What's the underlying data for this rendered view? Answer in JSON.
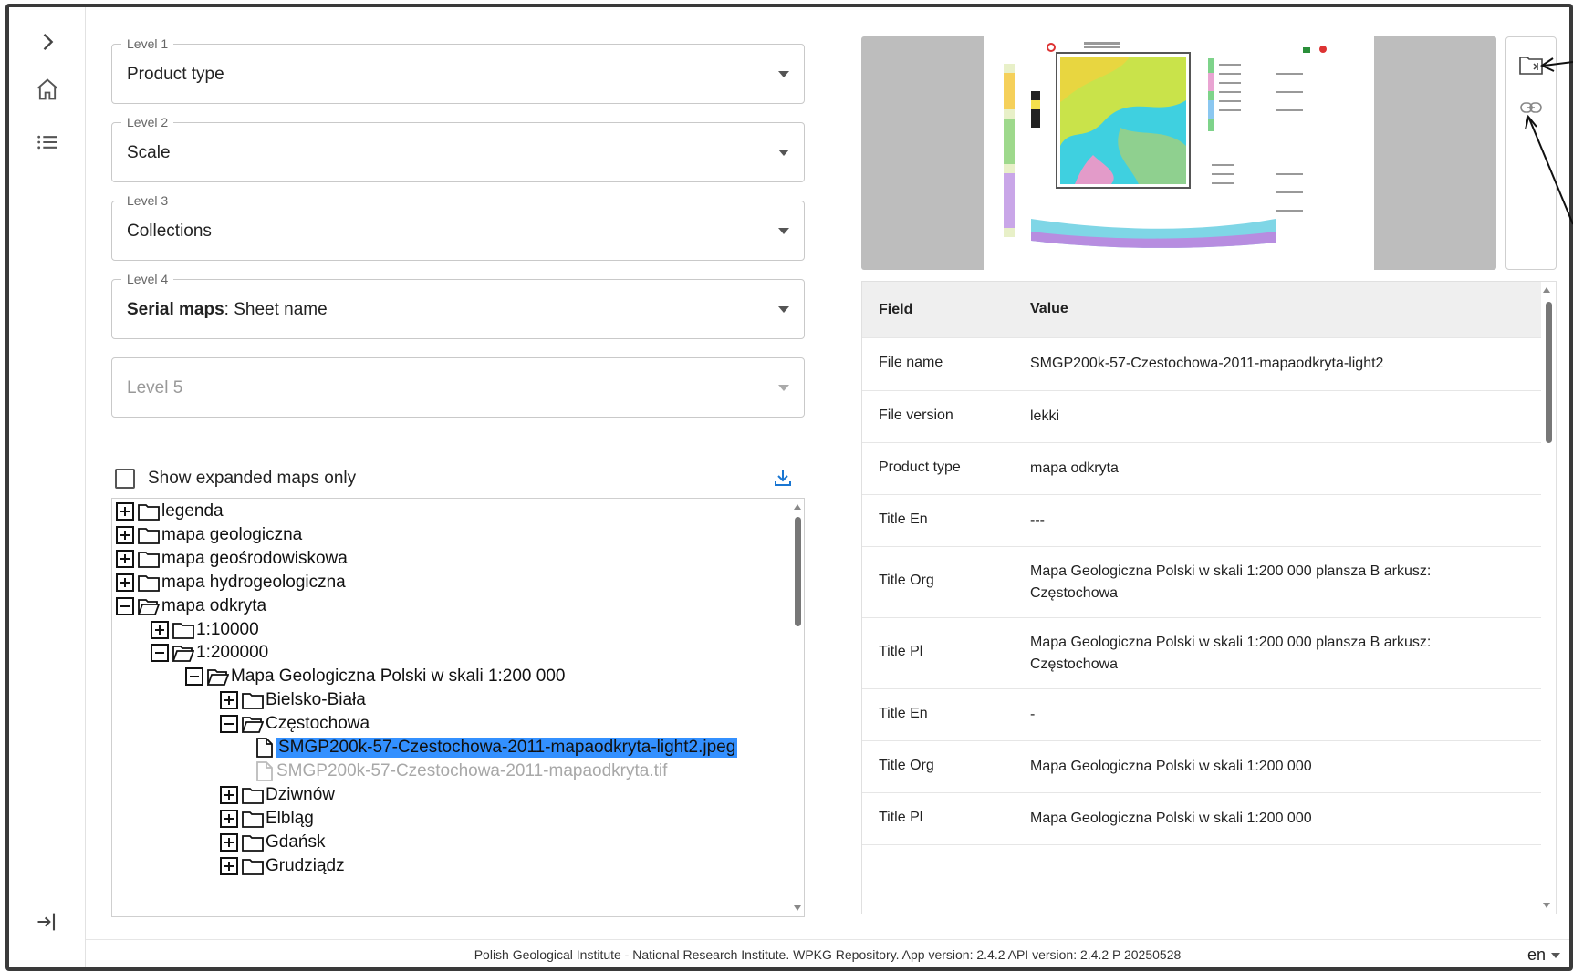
{
  "levels": [
    {
      "label": "Level 1",
      "value": "Product type"
    },
    {
      "label": "Level 2",
      "value": "Scale"
    },
    {
      "label": "Level 3",
      "value": "Collections"
    },
    {
      "label": "Level 4",
      "value_bold": "Serial maps",
      "value_rest": ": Sheet name"
    },
    {
      "placeholder": "Level 5"
    }
  ],
  "filter": {
    "show_expanded_label": "Show expanded maps only"
  },
  "tree": [
    {
      "label": "legenda"
    },
    {
      "label": "mapa geologiczna"
    },
    {
      "label": "mapa geośrodowiskowa"
    },
    {
      "label": "mapa hydrogeologiczna"
    },
    {
      "label": "mapa odkryta"
    },
    {
      "label": "1:10000"
    },
    {
      "label": "1:200000"
    },
    {
      "label": "Mapa Geologiczna Polski w skali 1:200 000"
    },
    {
      "label": "Bielsko-Biała"
    },
    {
      "label": "Częstochowa"
    },
    {
      "label": "SMGP200k-57-Czestochowa-2011-mapaodkryta-light2.jpeg"
    },
    {
      "label": "SMGP200k-57-Czestochowa-2011-mapaodkryta.tif"
    },
    {
      "label": "Dziwnów"
    },
    {
      "label": "Elbląg"
    },
    {
      "label": "Gdańsk"
    },
    {
      "label": "Grudziądz"
    }
  ],
  "metadata": {
    "header": {
      "field": "Field",
      "value": "Value"
    },
    "rows": [
      {
        "field": "File name",
        "value": "SMGP200k-57-Czestochowa-2011-mapaodkryta-light2"
      },
      {
        "field": "File version",
        "value": "lekki"
      },
      {
        "field": "Product type",
        "value": "mapa odkryta"
      },
      {
        "field": "Title En",
        "value": "---"
      },
      {
        "field": "Title Org",
        "value": "Mapa Geologiczna Polski w skali 1:200 000 plansza B arkusz: Częstochowa"
      },
      {
        "field": "Title Pl",
        "value": "Mapa Geologiczna Polski w skali 1:200 000 plansza B arkusz: Częstochowa"
      },
      {
        "field": "Title En",
        "value": "-"
      },
      {
        "field": "Title Org",
        "value": "Mapa Geologiczna Polski w skali 1:200 000"
      },
      {
        "field": "Title Pl",
        "value": "Mapa Geologiczna Polski w skali 1:200 000"
      }
    ]
  },
  "footer": {
    "text": "Polish Geological Institute - National Research Institute. WPKG Repository. App version: 2.4.2 API version: 2.4.2 P 20250528",
    "language": "en"
  },
  "icons": {
    "sidebar": [
      "chevron-right-icon",
      "home-icon",
      "list-icon",
      "login-icon"
    ],
    "tools": [
      "folder-preview-icon",
      "link-icon"
    ],
    "download": "download-icon"
  },
  "colors": {
    "selection": "#3390ff",
    "accent": "#1976d2"
  }
}
